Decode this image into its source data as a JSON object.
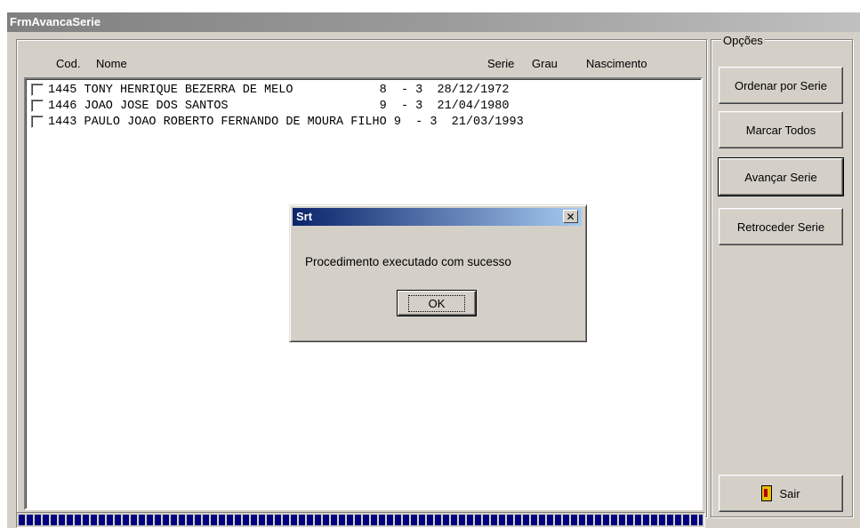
{
  "window": {
    "title": "FrmAvancaSerie"
  },
  "list": {
    "headers": {
      "cod": "Cod.",
      "nome": "Nome",
      "serie": "Serie",
      "grau": "Grau",
      "nascimento": "Nascimento"
    },
    "rows": [
      {
        "text": "1445 TONY HENRIQUE BEZERRA DE MELO            8  - 3  28/12/1972",
        "checked": false
      },
      {
        "text": "1446 JOAO JOSE DOS SANTOS                     9  - 3  21/04/1980",
        "checked": false
      },
      {
        "text": "1443 PAULO JOAO ROBERTO FERNANDO DE MOURA FILHO 9  - 3  21/03/1993",
        "checked": false
      }
    ]
  },
  "options": {
    "label": "Opções",
    "ordenar": "Ordenar por Serie",
    "marcar": "Marcar Todos",
    "avancar": "Avançar Serie",
    "retroceder": "Retroceder Serie",
    "sair": "Sair"
  },
  "progress": {
    "fraction": 1.0,
    "color": "#000080"
  },
  "dialog": {
    "title": "Srt",
    "close_glyph": "✕",
    "message": "Procedimento executado com sucesso",
    "ok_label": "OK"
  }
}
